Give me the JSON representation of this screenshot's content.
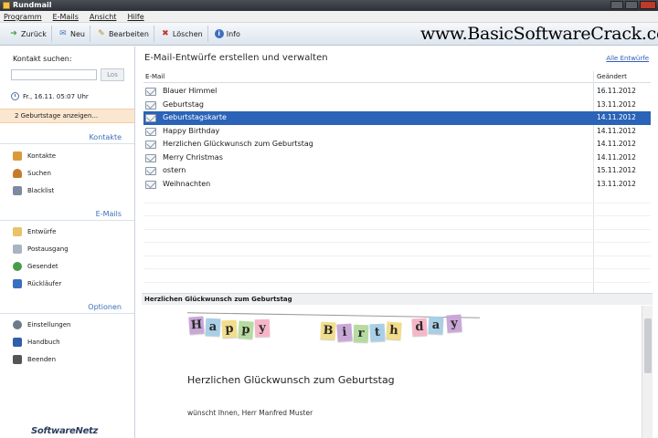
{
  "window": {
    "title": "Rundmail"
  },
  "menu": [
    "Programm",
    "E-Mails",
    "Ansicht",
    "Hilfe"
  ],
  "toolbar": {
    "back": "Zurück",
    "new": "Neu",
    "edit": "Bearbeiten",
    "delete": "Löschen",
    "info": "Info"
  },
  "watermark": "www.BasicSoftwareCrack.com",
  "sidebar": {
    "search_label": "Kontakt suchen:",
    "search_value": "",
    "search_button": "Los",
    "datetime": "Fr., 16.11.  05:07 Uhr",
    "birthday_notice": "2 Geburtstage anzeigen...",
    "sections": [
      {
        "title": "Kontakte",
        "items": [
          {
            "label": "Kontakte",
            "icon": "contacts-icon",
            "color": "#d99a3a"
          },
          {
            "label": "Suchen",
            "icon": "search-person-icon",
            "color": "#c77b2a"
          },
          {
            "label": "Blacklist",
            "icon": "blacklist-icon",
            "color": "#7d8aa0"
          }
        ]
      },
      {
        "title": "E-Mails",
        "items": [
          {
            "label": "Entwürfe",
            "icon": "drafts-icon",
            "color": "#e8c36a"
          },
          {
            "label": "Postausgang",
            "icon": "outbox-icon",
            "color": "#a8b4c2"
          },
          {
            "label": "Gesendet",
            "icon": "sent-icon",
            "color": "#4a9c4a"
          },
          {
            "label": "Rückläufer",
            "icon": "returns-icon",
            "color": "#3b6fc0"
          }
        ]
      },
      {
        "title": "Optionen",
        "items": [
          {
            "label": "Einstellungen",
            "icon": "settings-icon",
            "color": "#6c7a8a"
          },
          {
            "label": "Handbuch",
            "icon": "manual-icon",
            "color": "#2f5fa8"
          },
          {
            "label": "Beenden",
            "icon": "exit-icon",
            "color": "#555"
          }
        ]
      }
    ],
    "logo": "SoftwareNetz"
  },
  "main": {
    "title": "E-Mail-Entwürfe erstellen und verwalten",
    "all_link": "Alle Entwürfe",
    "columns": [
      "E-Mail",
      "Geändert"
    ],
    "rows": [
      {
        "name": "Blauer Himmel",
        "date": "16.11.2012"
      },
      {
        "name": "Geburtstag",
        "date": "13.11.2012"
      },
      {
        "name": "Geburtstagskarte",
        "date": "14.11.2012",
        "selected": true
      },
      {
        "name": "Happy Birthday",
        "date": "14.11.2012"
      },
      {
        "name": "Herzlichen Glückwunsch zum Geburtstag",
        "date": "14.11.2012"
      },
      {
        "name": "Merry Christmas",
        "date": "14.11.2012"
      },
      {
        "name": "ostern",
        "date": "15.11.2012"
      },
      {
        "name": "Weihnachten",
        "date": "13.11.2012"
      }
    ]
  },
  "preview": {
    "header": "Herzlichen Glückwunsch zum Geburtstag",
    "banner_letters": [
      {
        "ch": "H",
        "color": "#c9a8d8"
      },
      {
        "ch": "a",
        "color": "#a9cfe6"
      },
      {
        "ch": "p",
        "color": "#f2dd8a"
      },
      {
        "ch": "p",
        "color": "#b6dba0"
      },
      {
        "ch": "y",
        "color": "#f5b7c8"
      },
      {
        "ch": "B",
        "color": "#f2dd8a"
      },
      {
        "ch": "i",
        "color": "#c9a8d8"
      },
      {
        "ch": "r",
        "color": "#b6dba0"
      },
      {
        "ch": "t",
        "color": "#a9cfe6"
      },
      {
        "ch": "h",
        "color": "#f2dd8a"
      },
      {
        "ch": "d",
        "color": "#f5b7c8"
      },
      {
        "ch": "a",
        "color": "#a9cfe6"
      },
      {
        "ch": "y",
        "color": "#c9a8d8"
      }
    ],
    "greeting": "Herzlichen Glückwunsch zum Geburtstag",
    "text": "wünscht Ihnen, Herr Manfred Muster"
  }
}
